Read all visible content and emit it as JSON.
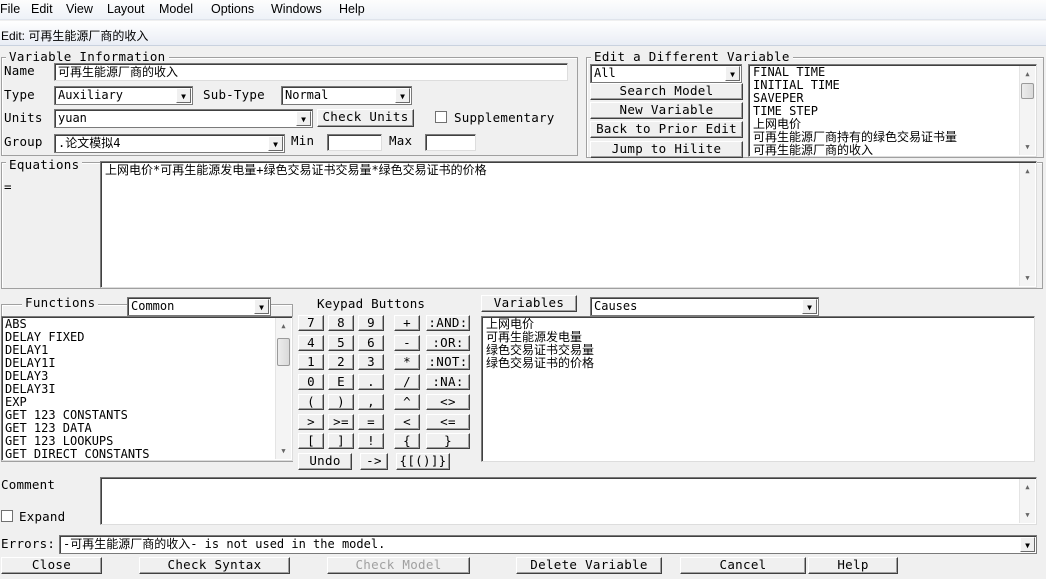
{
  "menu": [
    "File",
    "Edit",
    "View",
    "Layout",
    "Model",
    "Options",
    "Windows",
    "Help"
  ],
  "window_title": "Edit: 可再生能源厂商的收入",
  "variable_info": {
    "legend": "Variable Information",
    "name_label": "Name",
    "name_value": "可再生能源厂商的收入",
    "type_label": "Type",
    "type_value": "Auxiliary",
    "subtype_label": "Sub-Type",
    "subtype_value": "Normal",
    "units_label": "Units",
    "units_value": "yuan",
    "check_units": "Check Units",
    "supplementary_label": "Supplementary",
    "group_label": "Group",
    "group_value": ".论文模拟4",
    "min_label": "Min",
    "min_value": "",
    "max_label": "Max",
    "max_value": ""
  },
  "edit_different": {
    "legend": "Edit a Different Variable",
    "filter_value": "All",
    "search_model": "Search Model",
    "new_variable": "New Variable",
    "back_to_prior": "Back to Prior Edit",
    "jump_to_hilite": "Jump to Hilite",
    "items": [
      "FINAL TIME",
      "INITIAL TIME",
      "SAVEPER",
      "TIME STEP",
      "上网电价",
      "可再生能源厂商持有的绿色交易证书量",
      "可再生能源厂商的收入"
    ]
  },
  "equations": {
    "label": "Equations",
    "eq_sign": "=",
    "text": "上网电价*可再生能源发电量+绿色交易证书交易量*绿色交易证书的价格"
  },
  "functions": {
    "label": "Functions",
    "category": "Common",
    "items": [
      "ABS",
      "DELAY FIXED",
      "DELAY1",
      "DELAY1I",
      "DELAY3",
      "DELAY3I",
      "EXP",
      "GET 123 CONSTANTS",
      "GET 123 DATA",
      "GET 123 LOOKUPS",
      "GET DIRECT CONSTANTS"
    ]
  },
  "keypad": {
    "label": "Keypad Buttons",
    "rows": [
      [
        "7",
        "8",
        "9",
        "+",
        ":AND:"
      ],
      [
        "4",
        "5",
        "6",
        "-",
        ":OR:"
      ],
      [
        "1",
        "2",
        "3",
        "*",
        ":NOT:"
      ],
      [
        "0",
        "E",
        ".",
        "/",
        ":NA:"
      ],
      [
        "(",
        ")",
        ",",
        "^",
        "<>"
      ],
      [
        ">",
        ">=",
        "=",
        "<",
        "<="
      ],
      [
        "[",
        "]",
        "!",
        "{",
        "}"
      ]
    ],
    "undo": "Undo",
    "arrow": "->",
    "brackets": "{[()]}"
  },
  "variables": {
    "button": "Variables",
    "mode": "Causes",
    "items": [
      "上网电价",
      "可再生能源发电量",
      "绿色交易证书交易量",
      "绿色交易证书的价格"
    ]
  },
  "comment": {
    "label": "Comment",
    "expand_label": "Expand",
    "text": ""
  },
  "errors": {
    "label": "Errors:",
    "text": "-可再生能源厂商的收入- is not used in the model."
  },
  "bottom_buttons": {
    "close": "Close",
    "check_syntax": "Check Syntax",
    "check_model": "Check Model",
    "delete_variable": "Delete Variable",
    "cancel": "Cancel",
    "help": "Help"
  }
}
